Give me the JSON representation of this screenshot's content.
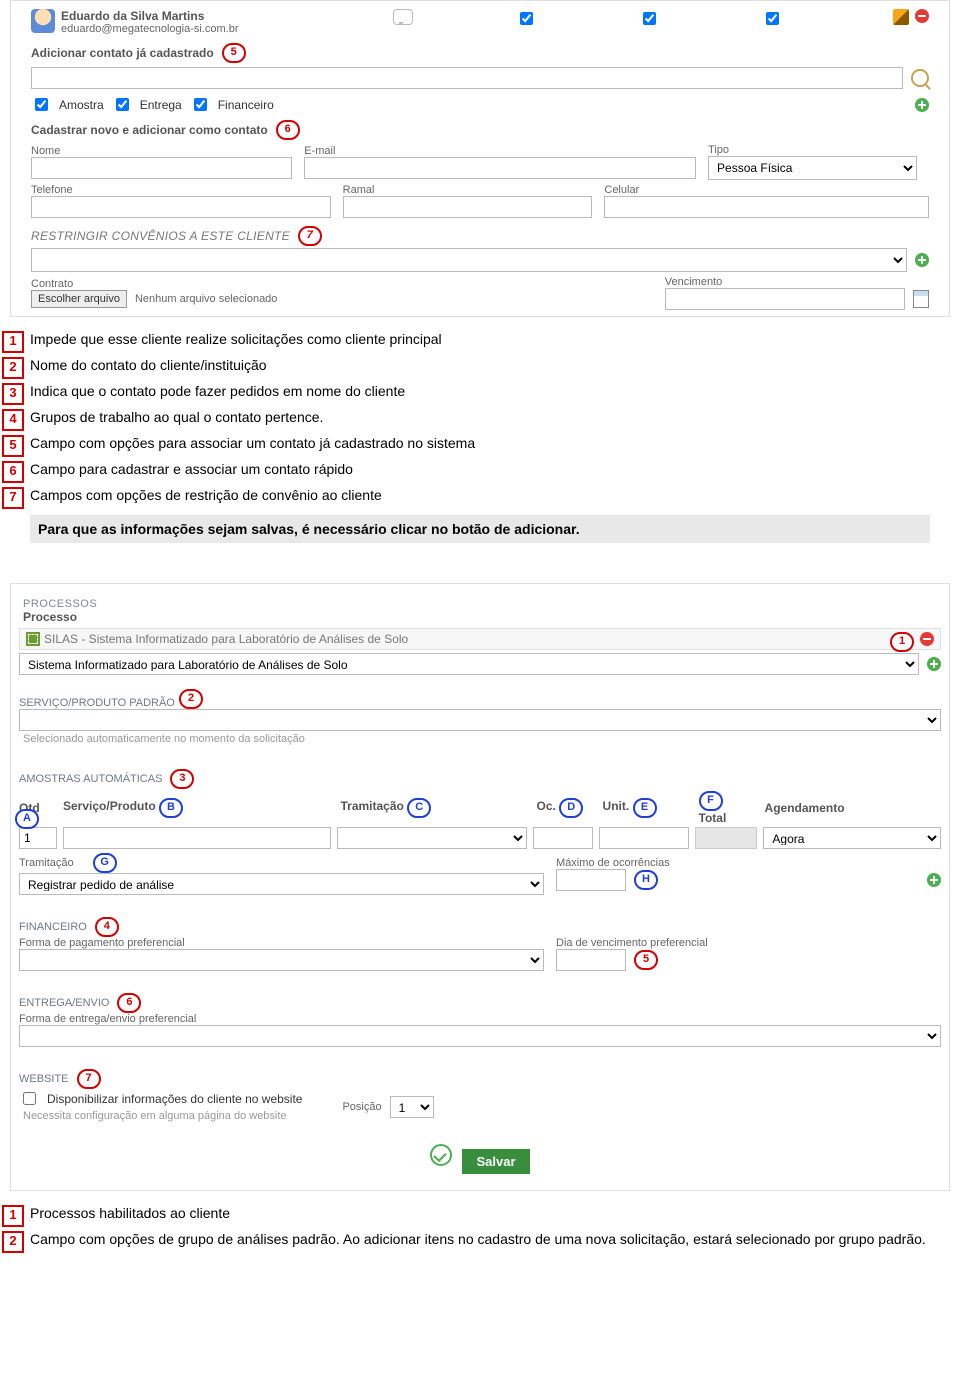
{
  "contact": {
    "name": "Eduardo da Silva Martins",
    "email": "eduardo@megatecnologia-si.com.br",
    "groups": [
      "Amostra",
      "Entrega",
      "Financeiro"
    ]
  },
  "section_add_existing": {
    "title": "Adicionar contato já cadastrado"
  },
  "section_new_contact": {
    "title": "Cadastrar novo e adicionar como contato",
    "labels": {
      "nome": "Nome",
      "email": "E-mail",
      "tipo": "Tipo",
      "tipo_value": "Pessoa Física",
      "telefone": "Telefone",
      "ramal": "Ramal",
      "celular": "Celular"
    }
  },
  "section_restrict": {
    "title": "RESTRINGIR CONVÊNIOS A ESTE CLIENTE",
    "contract_label": "Contrato",
    "file_btn": "Escolher arquivo",
    "file_none": "Nenhum arquivo selecionado",
    "venc_label": "Vencimento"
  },
  "legend1": {
    "items": [
      "Impede que esse cliente realize solicitações como cliente principal",
      "Nome do contato do cliente/instituição",
      "Indica que o contato pode fazer pedidos em nome do cliente",
      "Grupos de trabalho ao qual o contato pertence.",
      "Campo com opções para associar um contato já cadastrado no sistema",
      "Campo para cadastrar e associar um contato rápido",
      "Campos com opções de restrição de convênio ao cliente"
    ],
    "note": "Para que as informações sejam salvas, é necessário clicar no botão de adicionar."
  },
  "processos": {
    "head": "PROCESSOS",
    "sub": "Processo",
    "item": "SILAS - Sistema Informatizado para Laboratório de Análises de Solo",
    "select_value": "Sistema Informatizado para Laboratório de Análises de Solo"
  },
  "servico": {
    "head": "SERVIÇO/PRODUTO PADRÃO",
    "hint": "Selecionado automaticamente no momento da solicitação"
  },
  "amostras": {
    "head": "AMOSTRAS AUTOMÁTICAS",
    "cols": {
      "qtd": "Qtd",
      "serv": "Serviço/Produto",
      "tram": "Tramitação",
      "oc": "Oc.",
      "unit": "Unit.",
      "total": "Total",
      "agend": "Agendamento"
    },
    "qtd_value": "1",
    "agend_value": "Agora",
    "tram2_label": "Tramitação",
    "tram2_value": "Registrar pedido de análise",
    "maxoc_label": "Máximo de ocorrências"
  },
  "financeiro": {
    "head": "FINANCEIRO",
    "pay_label": "Forma de pagamento preferencial",
    "due_label": "Dia de vencimento preferencial"
  },
  "entrega": {
    "head": "ENTREGA/ENVIO",
    "label": "Forma de entrega/envio preferencial"
  },
  "website": {
    "head": "WEBSITE",
    "chk_label": "Disponibilizar informações do cliente no website",
    "hint": "Necessita configuração em alguma página do website",
    "pos_label": "Posição",
    "pos_value": "1"
  },
  "save": "Salvar",
  "legend2": {
    "items": [
      "Processos habilitados ao cliente",
      "Campo com opções de grupo de análises padrão. Ao adicionar itens no cadastro de uma nova solicitação, estará selecionado por grupo padrão."
    ]
  },
  "markers": {
    "r1": "1",
    "r2": "2",
    "r3": "3",
    "r4": "4",
    "r5": "5",
    "r6": "6",
    "r7": "7",
    "A": "A",
    "B": "B",
    "C": "C",
    "D": "D",
    "E": "E",
    "F": "F",
    "G": "G",
    "H": "H"
  }
}
